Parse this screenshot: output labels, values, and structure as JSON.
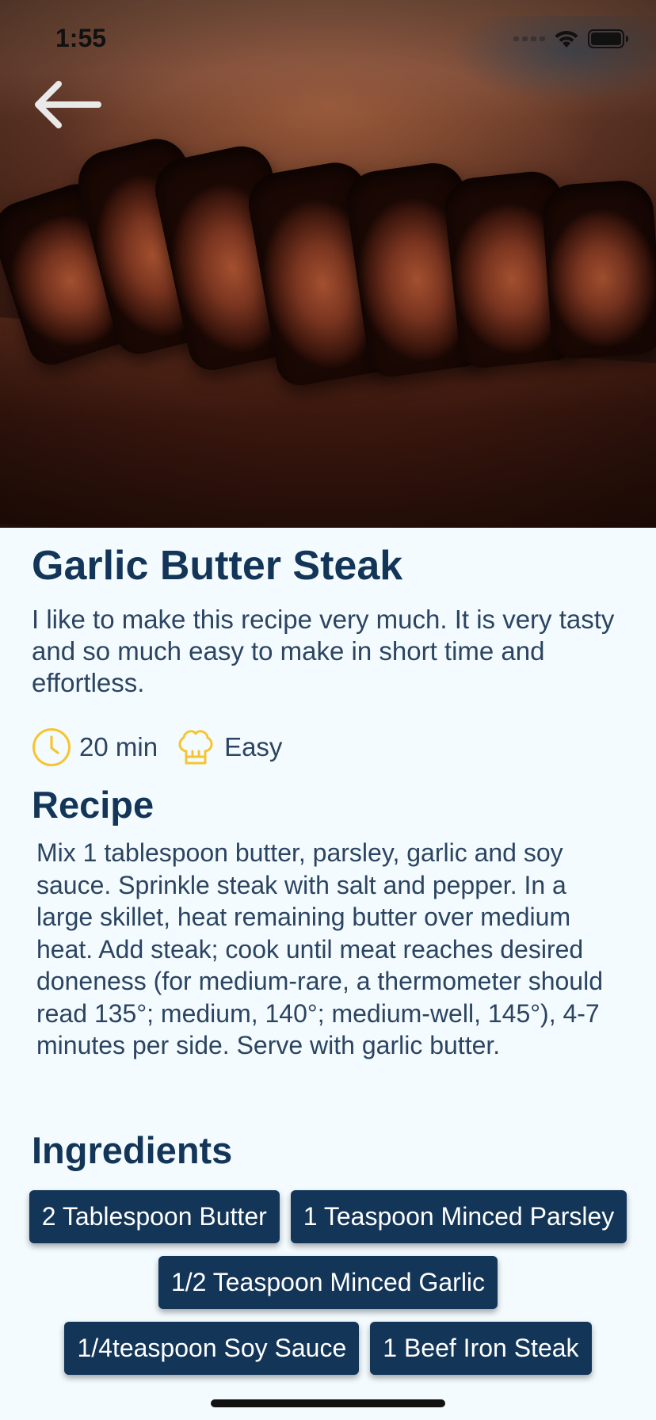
{
  "status_bar": {
    "time": "1:55"
  },
  "recipe": {
    "title": "Garlic Butter Steak",
    "description": "I like to make this recipe very much. It is very tasty and so much easy to make in short time and effortless.",
    "time": "20 min",
    "difficulty": "Easy",
    "recipe_heading": "Recipe",
    "recipe_text": "Mix 1 tablespoon butter, parsley, garlic and soy sauce. Sprinkle steak with salt and pepper. In a large skillet, heat remaining butter over medium heat. Add steak; cook until meat reaches desired doneness (for medium-rare, a thermometer should read 135°; medium, 140°; medium-well, 145°), 4-7 minutes per side. Serve with garlic butter.",
    "ingredients_heading": "Ingredients",
    "ingredients": [
      "2 Tablespoon Butter",
      "1 Teaspoon Minced Parsley",
      "1/2 Teaspoon Minced Garlic",
      "1/4teaspoon Soy Sauce",
      "1 Beef Iron Steak"
    ]
  },
  "icons": {
    "back": "back-arrow-icon",
    "clock": "clock-icon",
    "difficulty": "chef-hat-icon",
    "wifi": "wifi-icon",
    "battery": "battery-icon"
  },
  "colors": {
    "primary": "#123558",
    "background": "#f4fbff",
    "accent": "#f5c531",
    "chip_text": "#ffffff"
  }
}
